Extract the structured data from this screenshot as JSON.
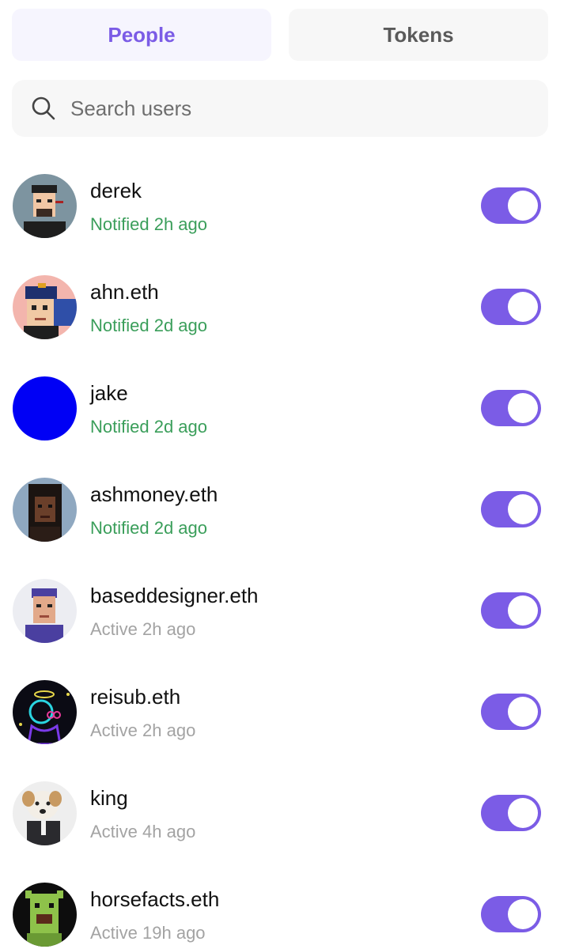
{
  "tabs": {
    "people": "People",
    "tokens": "Tokens",
    "active": "people"
  },
  "search": {
    "placeholder": "Search users",
    "value": ""
  },
  "colors": {
    "accent": "#7b5ce6",
    "notified": "#3a9e5a",
    "active_status": "#a3a3a3"
  },
  "users": [
    {
      "name": "derek",
      "status": "Notified 2h ago",
      "status_type": "notified",
      "enabled": true
    },
    {
      "name": "ahn.eth",
      "status": "Notified 2d ago",
      "status_type": "notified",
      "enabled": true
    },
    {
      "name": "jake",
      "status": "Notified 2d ago",
      "status_type": "notified",
      "enabled": true
    },
    {
      "name": "ashmoney.eth",
      "status": "Notified 2d ago",
      "status_type": "notified",
      "enabled": true
    },
    {
      "name": "baseddesigner.eth",
      "status": "Active 2h ago",
      "status_type": "active",
      "enabled": true
    },
    {
      "name": "reisub.eth",
      "status": "Active 2h ago",
      "status_type": "active",
      "enabled": true
    },
    {
      "name": "king",
      "status": "Active 4h ago",
      "status_type": "active",
      "enabled": true
    },
    {
      "name": "horsefacts.eth",
      "status": "Active 19h ago",
      "status_type": "active",
      "enabled": true
    }
  ]
}
